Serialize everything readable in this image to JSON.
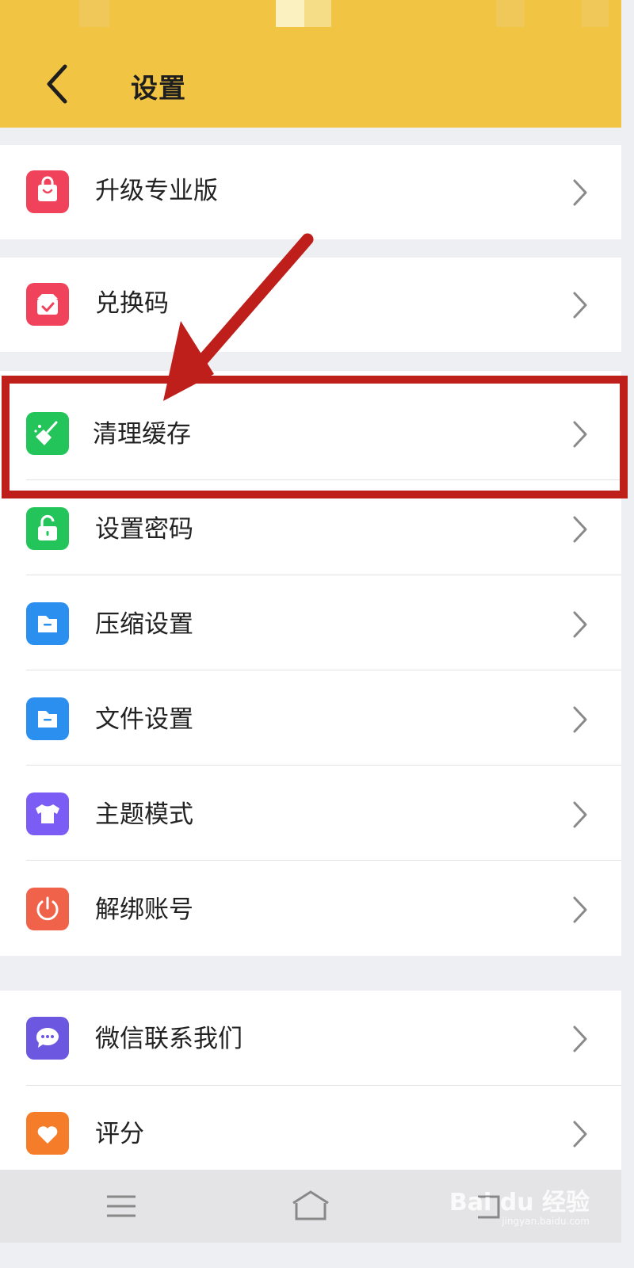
{
  "header": {
    "title": "设置",
    "back_icon": "chevron-left-icon"
  },
  "colors": {
    "header_bg": "#f1c443",
    "page_bg": "#eeeff3",
    "highlight": "#bf1f1b",
    "chevron": "#8a8a8a"
  },
  "groups": [
    {
      "items": [
        {
          "label": "升级专业版",
          "icon": "shopping-bag-icon",
          "icon_color": "#f0435b"
        }
      ]
    },
    {
      "items": [
        {
          "label": "兑换码",
          "icon": "gift-box-icon",
          "icon_color": "#f0435b"
        }
      ]
    },
    {
      "items": [
        {
          "label": "清理缓存",
          "icon": "broom-icon",
          "icon_color": "#23c55a",
          "highlighted": true
        },
        {
          "label": "设置密码",
          "icon": "lock-icon",
          "icon_color": "#23c55a"
        },
        {
          "label": "压缩设置",
          "icon": "folder-icon",
          "icon_color": "#2b8ff0"
        },
        {
          "label": "文件设置",
          "icon": "folder-icon",
          "icon_color": "#2b8ff0"
        },
        {
          "label": "主题模式",
          "icon": "tshirt-icon",
          "icon_color": "#7b5cf5"
        },
        {
          "label": "解绑账号",
          "icon": "power-icon",
          "icon_color": "#f0624a"
        }
      ]
    },
    {
      "items": [
        {
          "label": "微信联系我们",
          "icon": "chat-bubble-icon",
          "icon_color": "#6b57e0"
        },
        {
          "label": "评分",
          "icon": "heart-icon",
          "icon_color": "#f57c28"
        }
      ]
    }
  ],
  "nav": {
    "menu_icon": "menu-icon",
    "home_icon": "home-icon",
    "back_icon": "back-icon"
  },
  "watermark": {
    "text": "Bai du 经验",
    "sub": "jingyan.baidu.com"
  }
}
